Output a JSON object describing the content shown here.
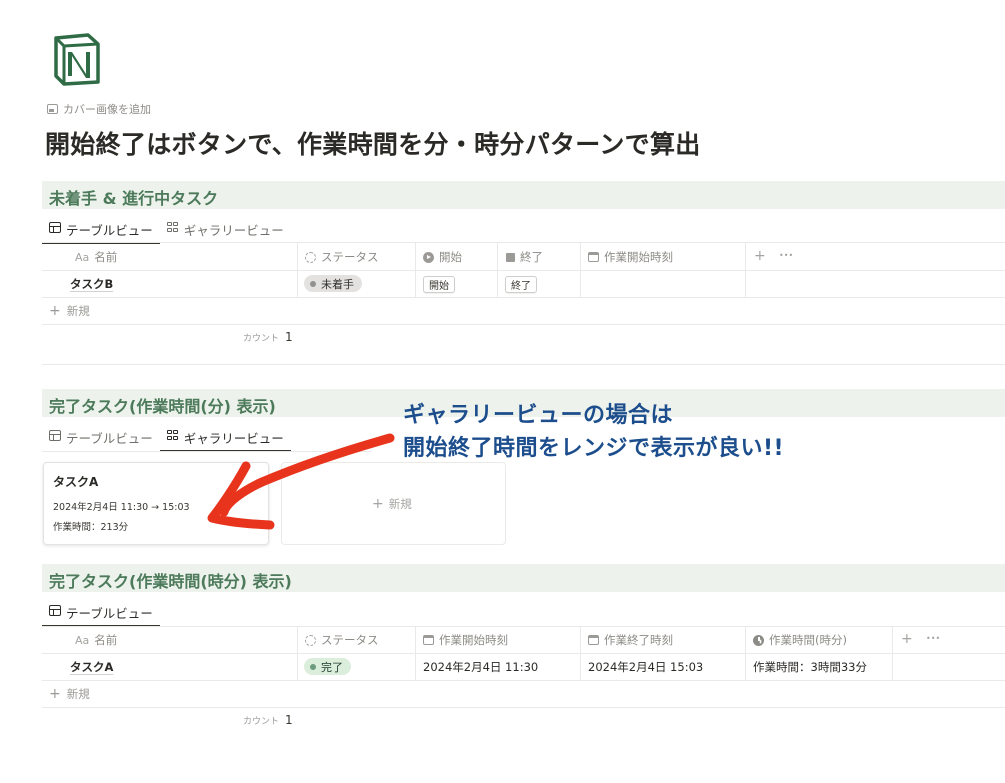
{
  "page": {
    "add_cover_label": "カバー画像を追加",
    "title": "開始終了はボタンで、作業時間を分・時分パターンで算出"
  },
  "section1": {
    "title": "未着手 & 進行中タスク",
    "tabs": [
      {
        "label": "テーブルビュー",
        "active": true
      },
      {
        "label": "ギャラリービュー",
        "active": false
      }
    ],
    "columns": [
      {
        "aa": "Aa",
        "label": "名前"
      },
      {
        "label": "ステータス"
      },
      {
        "label": "開始"
      },
      {
        "label": "終了"
      },
      {
        "label": "作業開始時刻"
      }
    ],
    "add_column": "+",
    "more": "•••",
    "rows": [
      {
        "name": "タスクB",
        "status": "未着手",
        "start_button": "開始",
        "end_button": "終了"
      }
    ],
    "new_label": "新規",
    "count_label": "カウント",
    "count_value": "1"
  },
  "section2": {
    "title": "完了タスク(作業時間(分) 表示)",
    "tabs": [
      {
        "label": "テーブルビュー",
        "active": false
      },
      {
        "label": "ギャラリービュー",
        "active": true
      }
    ],
    "card": {
      "title": "タスクA",
      "date_range": "2024年2月4日 11:30 → 15:03",
      "duration": "作業時間：213分"
    },
    "new_card_label": "新規"
  },
  "annotation": {
    "line1": "ギャラリービューの場合は",
    "line2": "開始終了時間をレンジで表示が良い!!",
    "color": "#1c4d8c",
    "arrow_color": "#e8341c"
  },
  "section3": {
    "title": "完了タスク(作業時間(時分) 表示)",
    "tabs": [
      {
        "label": "テーブルビュー",
        "active": true
      }
    ],
    "columns": [
      {
        "aa": "Aa",
        "label": "名前"
      },
      {
        "label": "ステータス"
      },
      {
        "label": "作業開始時刻"
      },
      {
        "label": "作業終了時刻"
      },
      {
        "label": "作業時間(時分)"
      }
    ],
    "add_column": "+",
    "more": "•••",
    "rows": [
      {
        "name": "タスクA",
        "status": "完了",
        "start": "2024年2月4日 11:30",
        "end": "2024年2月4日 15:03",
        "duration": "作業時間：3時間33分"
      }
    ],
    "new_label": "新規",
    "count_label": "カウント",
    "count_value": "1"
  },
  "colors": {
    "section_bar": "#edf3ec",
    "section_title": "#4c7a5a",
    "status_gray": "#e3e2e0",
    "status_green": "#dbeddb"
  }
}
